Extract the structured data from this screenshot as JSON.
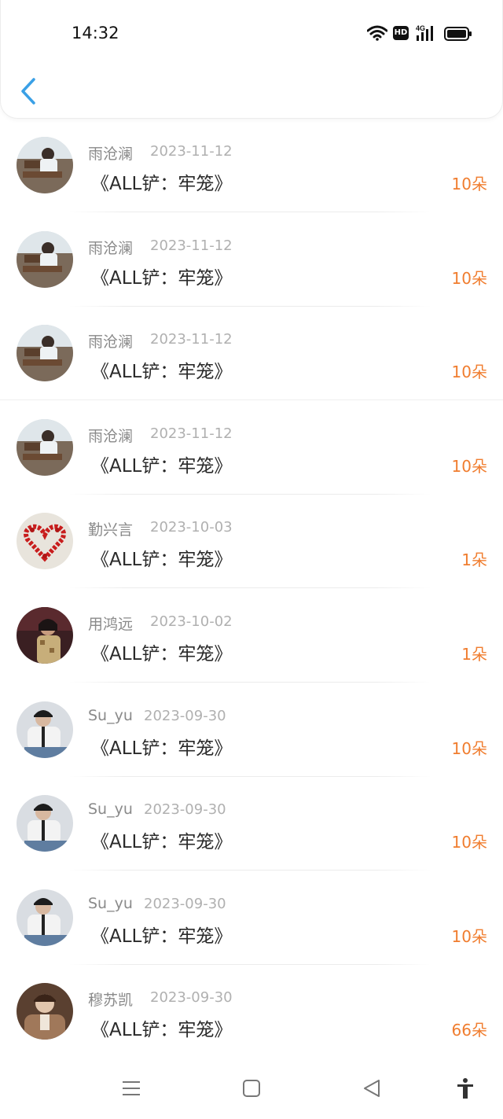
{
  "status_bar": {
    "time": "14:32",
    "hd_label": "HD",
    "network_label": "4G"
  },
  "header": {
    "back_icon": "chevron-left-icon"
  },
  "colors": {
    "accent": "#3aa0e6",
    "count": "#f07d2f",
    "name": "#8a8a8a",
    "date": "#b0b0b0"
  },
  "items": [
    {
      "name": "雨沧澜",
      "date": "2023-11-12",
      "title": "《ALL铲：牢笼》",
      "count": "10朵",
      "avatar": "cliff-sitting"
    },
    {
      "name": "雨沧澜",
      "date": "2023-11-12",
      "title": "《ALL铲：牢笼》",
      "count": "10朵",
      "avatar": "cliff-sitting"
    },
    {
      "name": "雨沧澜",
      "date": "2023-11-12",
      "title": "《ALL铲：牢笼》",
      "count": "10朵",
      "avatar": "cliff-sitting"
    },
    {
      "name": "雨沧澜",
      "date": "2023-11-12",
      "title": "《ALL铲：牢笼》",
      "count": "10朵",
      "avatar": "cliff-sitting"
    },
    {
      "name": "勤兴言",
      "date": "2023-10-03",
      "title": "《ALL铲：牢笼》",
      "count": "1朵",
      "avatar": "rose-heart"
    },
    {
      "name": "用鸿远",
      "date": "2023-10-02",
      "title": "《ALL铲：牢笼》",
      "count": "1朵",
      "avatar": "dark-portrait"
    },
    {
      "name": "Su_yu",
      "date": "2023-09-30",
      "title": "《ALL铲：牢笼》",
      "count": "10朵",
      "avatar": "young-man-jacket"
    },
    {
      "name": "Su_yu",
      "date": "2023-09-30",
      "title": "《ALL铲：牢笼》",
      "count": "10朵",
      "avatar": "young-man-jacket"
    },
    {
      "name": "Su_yu",
      "date": "2023-09-30",
      "title": "《ALL铲：牢笼》",
      "count": "10朵",
      "avatar": "young-man-jacket"
    },
    {
      "name": "穆苏凯",
      "date": "2023-09-30",
      "title": "《ALL铲：牢笼》",
      "count": "66朵",
      "avatar": "brown-coat"
    }
  ],
  "navbar": {
    "icons": [
      "menu-icon",
      "home-square-icon",
      "back-triangle-icon",
      "accessibility-icon"
    ]
  }
}
